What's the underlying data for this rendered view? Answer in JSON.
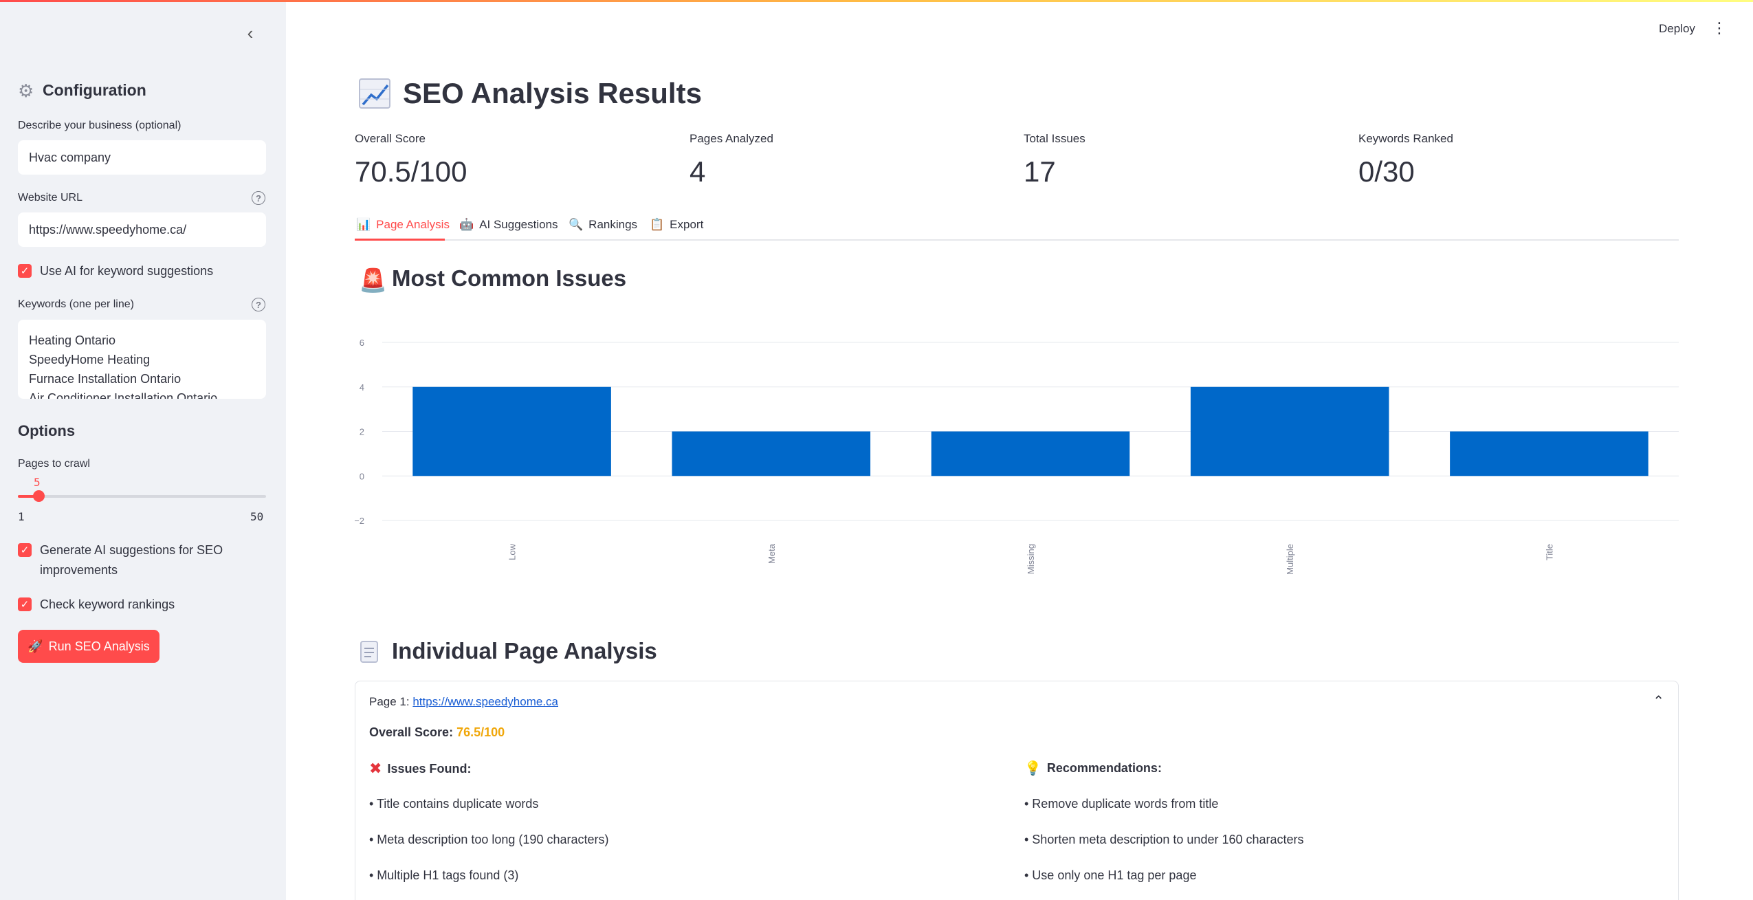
{
  "header": {
    "deploy_label": "Deploy",
    "menu_icon": "kebab-menu-icon"
  },
  "sidebar": {
    "collapse_icon": "chevron-left-icon",
    "title": "Configuration",
    "business_label": "Describe your business (optional)",
    "business_value": "Hvac company",
    "url_label": "Website URL",
    "url_value": "https://www.speedyhome.ca/",
    "use_ai_label": "Use AI for keyword suggestions",
    "keywords_label": "Keywords (one per line)",
    "keywords": [
      "Heating Ontario",
      "SpeedyHome Heating",
      "Furnace Installation Ontario",
      "Air Conditioner Installation Ontario"
    ],
    "options_title": "Options",
    "pages_label": "Pages to crawl",
    "pages_value": "5",
    "pages_min": "1",
    "pages_max": "50",
    "gen_ai_label": "Generate AI suggestions for SEO improvements",
    "rankings_label": "Check keyword rankings",
    "run_label": "Run SEO Analysis"
  },
  "main": {
    "title": "SEO Analysis Results",
    "metrics": [
      {
        "label": "Overall Score",
        "value": "70.5/100"
      },
      {
        "label": "Pages Analyzed",
        "value": "4"
      },
      {
        "label": "Total Issues",
        "value": "17"
      },
      {
        "label": "Keywords Ranked",
        "value": "0/30"
      }
    ],
    "tabs": [
      {
        "label": "Page Analysis",
        "icon": "bar-chart-icon"
      },
      {
        "label": "AI Suggestions",
        "icon": "robot-icon"
      },
      {
        "label": "Rankings",
        "icon": "magnifier-icon"
      },
      {
        "label": "Export",
        "icon": "clipboard-icon"
      }
    ],
    "issues_title": "Most Common Issues",
    "page_analysis_title": "Individual Page Analysis",
    "page1": {
      "label": "Page 1:",
      "url": "https://www.speedyhome.ca",
      "score_label": "Overall Score:",
      "score_value": "76.5/100",
      "issues_title": "Issues Found:",
      "issues": [
        "• Title contains duplicate words",
        "• Meta description too long (190 characters)",
        "• Multiple H1 tags found (3)"
      ],
      "recs_title": "Recommendations:",
      "recs": [
        "• Remove duplicate words from title",
        "• Shorten meta description to under 160 characters",
        "• Use only one H1 tag per page"
      ]
    }
  },
  "chart_data": {
    "type": "bar",
    "categories": [
      "Low",
      "Meta",
      "Missing",
      "Multiple",
      "Title"
    ],
    "values": [
      4,
      2,
      2,
      4,
      2
    ],
    "ylim": [
      -2,
      6
    ],
    "yticks": [
      -2,
      0,
      2,
      4,
      6
    ],
    "bar_color": "#0068c9",
    "grid": true,
    "xlabel": "",
    "ylabel": ""
  }
}
